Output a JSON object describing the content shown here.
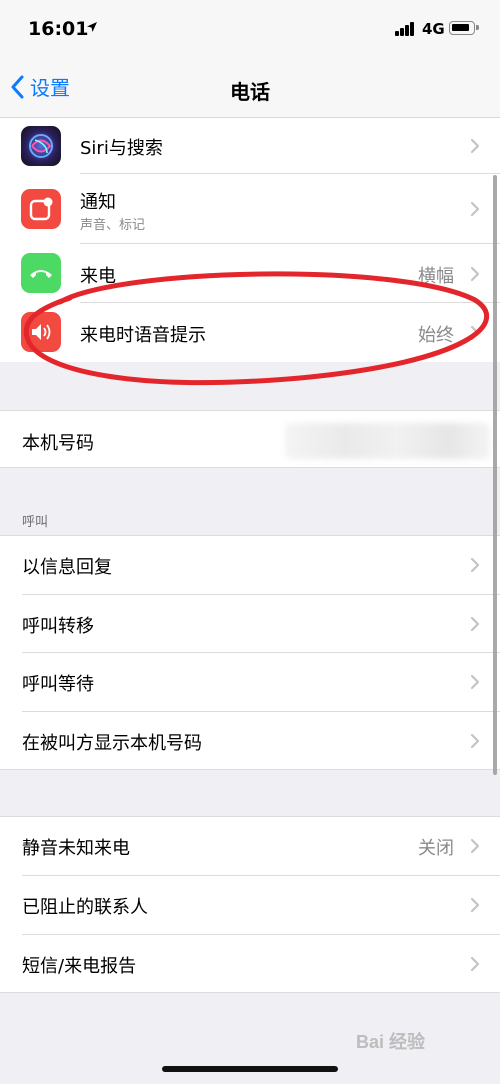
{
  "status_bar": {
    "time": "16:01",
    "network": "4G"
  },
  "nav": {
    "back_label": "设置",
    "title": "电话"
  },
  "apps_group": [
    {
      "label": "Siri与搜索",
      "icon": "siri-icon",
      "color": "#3b2e6e"
    },
    {
      "label": "通知",
      "subtitle": "声音、标记",
      "icon": "notifications-icon",
      "color": "#f24a40"
    },
    {
      "label": "来电",
      "value": "横幅",
      "icon": "incoming-call-icon",
      "color": "#4cd964"
    },
    {
      "label": "来电时语音提示",
      "value": "始终",
      "icon": "announce-calls-icon",
      "color": "#f24a40"
    }
  ],
  "my_number": {
    "label": "本机号码"
  },
  "calls_section": {
    "header": "呼叫",
    "items": [
      {
        "label": "以信息回复"
      },
      {
        "label": "呼叫转移"
      },
      {
        "label": "呼叫等待"
      },
      {
        "label": "在被叫方显示本机号码"
      }
    ]
  },
  "silence_group": [
    {
      "label": "静音未知来电",
      "value": "关闭"
    },
    {
      "label": "已阻止的联系人"
    },
    {
      "label": "短信/来电报告"
    }
  ],
  "watermark": "Bai 经验",
  "colors": {
    "accent": "#0a7aff",
    "annotation": "#e3262b"
  }
}
